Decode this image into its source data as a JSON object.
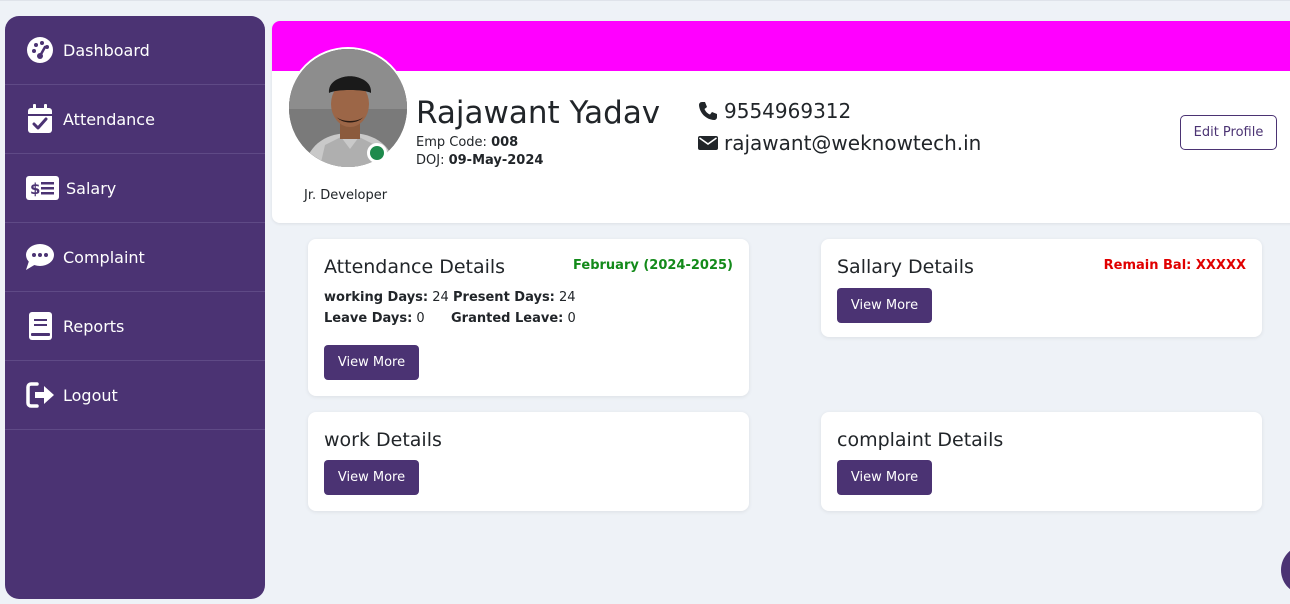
{
  "sidebar": {
    "items": [
      {
        "label": "Dashboard",
        "icon": "dashboard-gauge-icon"
      },
      {
        "label": "Attendance",
        "icon": "calendar-check-icon"
      },
      {
        "label": "Salary",
        "icon": "money-check-icon"
      },
      {
        "label": "Complaint",
        "icon": "chat-bubble-icon"
      },
      {
        "label": "Reports",
        "icon": "book-icon"
      },
      {
        "label": "Logout",
        "icon": "logout-icon"
      }
    ]
  },
  "profile": {
    "name": "Rajawant Yadav",
    "emp_code_label": "Emp Code: ",
    "emp_code": "008",
    "doj_label": "DOJ: ",
    "doj": "09-May-2024",
    "role": "Jr. Developer",
    "phone": "9554969312",
    "email": "rajawant@weknowtech.in",
    "edit_label": "Edit Profile",
    "status": "online"
  },
  "attendance": {
    "title": "Attendance Details",
    "period": "February (2024-2025)",
    "working_days_label": "working Days:",
    "working_days": "24",
    "present_days_label": "Present Days:",
    "present_days": "24",
    "leave_days_label": "Leave Days:",
    "leave_days": "0",
    "granted_leave_label": "Granted Leave:",
    "granted_leave": "0",
    "button": "View More"
  },
  "salary": {
    "title": "Sallary Details",
    "remain": "Remain Bal: XXXXX",
    "button": "View More"
  },
  "work": {
    "title": "work Details",
    "button": "View More"
  },
  "complaint": {
    "title": "complaint Details",
    "button": "View More"
  },
  "colors": {
    "sidebar": "#4b3373",
    "banner": "#ff00ff",
    "period_text": "#138a1a",
    "remain_text": "#e00000",
    "status_dot": "#1e8a4c",
    "background": "#eef2f7"
  }
}
